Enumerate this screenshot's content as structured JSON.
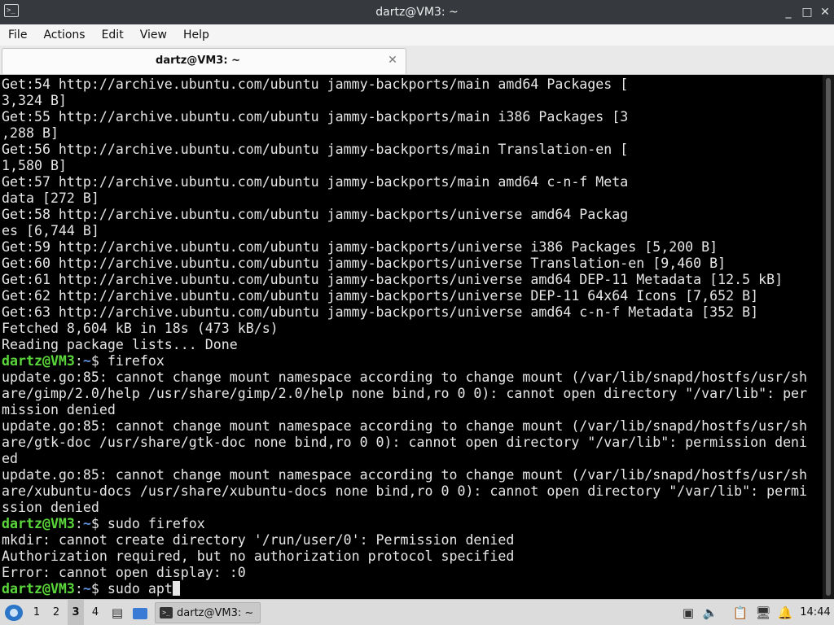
{
  "window": {
    "title": "dartz@VM3: ~",
    "controls": {
      "minimize": "_",
      "maximize": "□",
      "close": "✕"
    }
  },
  "menu": [
    "File",
    "Actions",
    "Edit",
    "View",
    "Help"
  ],
  "tab": {
    "label": "dartz@VM3: ~",
    "close": "✕"
  },
  "terminal": {
    "lines": [
      "Get:54 http://archive.ubuntu.com/ubuntu jammy-backports/main amd64 Packages [",
      "3,324 B]",
      "Get:55 http://archive.ubuntu.com/ubuntu jammy-backports/main i386 Packages [3",
      ",288 B]",
      "Get:56 http://archive.ubuntu.com/ubuntu jammy-backports/main Translation-en [",
      "1,580 B]",
      "Get:57 http://archive.ubuntu.com/ubuntu jammy-backports/main amd64 c-n-f Meta",
      "data [272 B]",
      "Get:58 http://archive.ubuntu.com/ubuntu jammy-backports/universe amd64 Packag",
      "es [6,744 B]",
      "Get:59 http://archive.ubuntu.com/ubuntu jammy-backports/universe i386 Packages [5,200 B]",
      "Get:60 http://archive.ubuntu.com/ubuntu jammy-backports/universe Translation-en [9,460 B]",
      "Get:61 http://archive.ubuntu.com/ubuntu jammy-backports/universe amd64 DEP-11 Metadata [12.5 kB]",
      "Get:62 http://archive.ubuntu.com/ubuntu jammy-backports/universe DEP-11 64x64 Icons [7,652 B]",
      "Get:63 http://archive.ubuntu.com/ubuntu jammy-backports/universe amd64 c-n-f Metadata [352 B]",
      "Fetched 8,604 kB in 18s (473 kB/s)",
      "Reading package lists... Done",
      {
        "prompt": true,
        "user": "dartz@VM3",
        "sep": ":",
        "path": "~",
        "sym": "$ ",
        "cmd": "firefox"
      },
      "update.go:85: cannot change mount namespace according to change mount (/var/lib/snapd/hostfs/usr/sh",
      "are/gimp/2.0/help /usr/share/gimp/2.0/help none bind,ro 0 0): cannot open directory \"/var/lib\": per",
      "mission denied",
      "update.go:85: cannot change mount namespace according to change mount (/var/lib/snapd/hostfs/usr/sh",
      "are/gtk-doc /usr/share/gtk-doc none bind,ro 0 0): cannot open directory \"/var/lib\": permission deni",
      "ed",
      "update.go:85: cannot change mount namespace according to change mount (/var/lib/snapd/hostfs/usr/sh",
      "are/xubuntu-docs /usr/share/xubuntu-docs none bind,ro 0 0): cannot open directory \"/var/lib\": permi",
      "ssion denied",
      {
        "prompt": true,
        "user": "dartz@VM3",
        "sep": ":",
        "path": "~",
        "sym": "$ ",
        "cmd": "sudo firefox"
      },
      "mkdir: cannot create directory '/run/user/0': Permission denied",
      "Authorization required, but no authorization protocol specified",
      "Error: cannot open display: :0",
      {
        "prompt": true,
        "user": "dartz@VM3",
        "sep": ":",
        "path": "~",
        "sym": "$ ",
        "cmd": "sudo apt",
        "cursor": true
      }
    ]
  },
  "taskbar": {
    "workspaces": [
      "1",
      "2",
      "3",
      "4"
    ],
    "active_workspace": "3",
    "window_button": {
      "label": "dartz@VM3: ~",
      "icon": ">_"
    },
    "clock": "14:44",
    "tray_icons": [
      "notes-icon",
      "volume-icon",
      "clipboard-icon",
      "network-icon",
      "notification-icon"
    ]
  },
  "colors": {
    "prompt_user": "#5ad73a",
    "prompt_path": "#5f8fd9",
    "terminal_bg": "#000000",
    "terminal_fg": "#e6e6e6"
  }
}
